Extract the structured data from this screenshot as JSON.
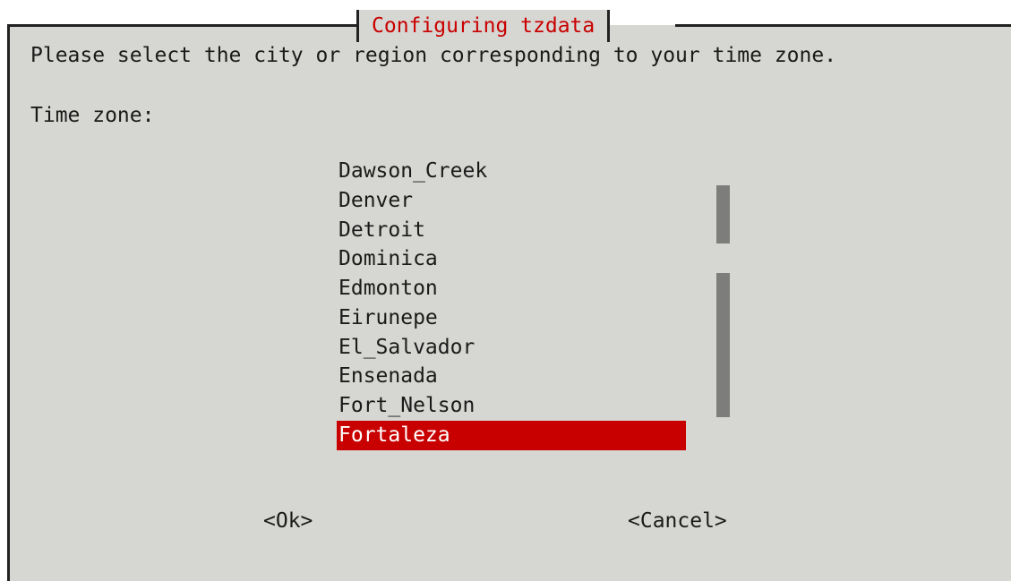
{
  "dialog": {
    "title": "Configuring tzdata",
    "prompt": "Please select the city or region corresponding to your time zone.",
    "field_label": "Time zone:"
  },
  "list": {
    "items": [
      "Dawson_Creek",
      "Denver",
      "Detroit",
      "Dominica",
      "Edmonton",
      "Eirunepe",
      "El_Salvador",
      "Ensenada",
      "Fort_Nelson",
      "Fortaleza"
    ],
    "selected": "Fortaleza"
  },
  "buttons": {
    "ok": "<Ok>",
    "cancel": "<Cancel>"
  },
  "colors": {
    "background": "#d6d6d2",
    "accent": "#c90000",
    "frame": "#222222",
    "scrollbar": "#7d7d7b"
  }
}
